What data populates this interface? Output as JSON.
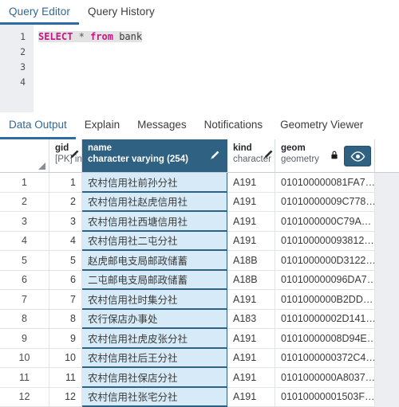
{
  "top_tabs": [
    {
      "label": "Query Editor",
      "active": true
    },
    {
      "label": "Query History",
      "active": false
    }
  ],
  "editor": {
    "line_numbers": [
      "1",
      "2",
      "3",
      "4"
    ],
    "sql_tokens": [
      {
        "text": "SELECT",
        "kind": "keyword"
      },
      {
        "text": " ",
        "kind": "plain"
      },
      {
        "text": "*",
        "kind": "operator"
      },
      {
        "text": " ",
        "kind": "plain"
      },
      {
        "text": "from",
        "kind": "keyword"
      },
      {
        "text": " ",
        "kind": "plain"
      },
      {
        "text": "bank",
        "kind": "identifier"
      }
    ],
    "sql_text": "SELECT * from bank"
  },
  "panel_tabs": [
    {
      "label": "Data Output",
      "active": true
    },
    {
      "label": "Explain",
      "active": false
    },
    {
      "label": "Messages",
      "active": false
    },
    {
      "label": "Notifications",
      "active": false
    },
    {
      "label": "Geometry Viewer",
      "active": false
    }
  ],
  "grid": {
    "columns": [
      {
        "name": "",
        "type": "",
        "selected": false,
        "icon": "sort-corner-icon"
      },
      {
        "name": "gid",
        "type": "[PK] int",
        "selected": false,
        "icon": "pencil-icon"
      },
      {
        "name": "name",
        "type": "character varying (254)",
        "selected": true,
        "icon": "pencil-icon"
      },
      {
        "name": "kind",
        "type": "character",
        "selected": false,
        "icon": "pencil-icon"
      },
      {
        "name": "geom",
        "type": "geometry",
        "selected": false,
        "icon": "lock-icon",
        "icon2": "eye-icon"
      }
    ],
    "rows": [
      {
        "n": "1",
        "gid": "1",
        "name": "农村信用社前孙分社",
        "kind": "A191",
        "geom": "010100000081FA7…"
      },
      {
        "n": "2",
        "gid": "2",
        "name": "农村信用社赵虎信用社",
        "kind": "A191",
        "geom": "01010000009C778…"
      },
      {
        "n": "3",
        "gid": "3",
        "name": "农村信用社西塘信用社",
        "kind": "A191",
        "geom": "0101000000C79A…"
      },
      {
        "n": "4",
        "gid": "4",
        "name": "农村信用社二屯分社",
        "kind": "A191",
        "geom": "010100000093812…"
      },
      {
        "n": "5",
        "gid": "5",
        "name": "赵虎邮电支局邮政储蓄",
        "kind": "A18B",
        "geom": "0101000000D3122…"
      },
      {
        "n": "6",
        "gid": "6",
        "name": "二屯邮电支局邮政储蓄",
        "kind": "A18B",
        "geom": "010100000096DA7…"
      },
      {
        "n": "7",
        "gid": "7",
        "name": "农村信用社时集分社",
        "kind": "A191",
        "geom": "0101000000B2DD…"
      },
      {
        "n": "8",
        "gid": "8",
        "name": "农行保店办事处",
        "kind": "A183",
        "geom": "01010000002D141…"
      },
      {
        "n": "9",
        "gid": "9",
        "name": "农村信用社虎皮张分社",
        "kind": "A191",
        "geom": "01010000008D94E…"
      },
      {
        "n": "10",
        "gid": "10",
        "name": "农村信用社后王分社",
        "kind": "A191",
        "geom": "0101000000372C4…"
      },
      {
        "n": "11",
        "gid": "11",
        "name": "农村信用社保店分社",
        "kind": "A191",
        "geom": "0101000000A8037…"
      },
      {
        "n": "12",
        "gid": "12",
        "name": "农村信用社张宅分社",
        "kind": "A191",
        "geom": "01010000001503F…"
      }
    ]
  },
  "colors": {
    "accent": "#2d6ca2",
    "header_selected_bg": "#2f6183",
    "cell_selected_bg": "#d6ebf7",
    "gutter_bg": "#eceef2",
    "keyword": "#c71585"
  }
}
